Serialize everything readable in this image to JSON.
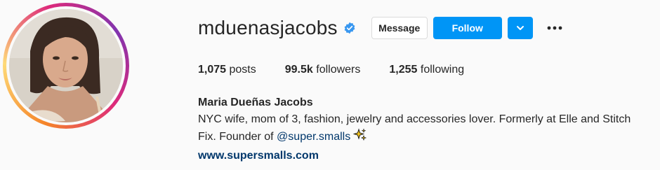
{
  "profile": {
    "username": "mduenasjacobs",
    "verified_icon": "verified-badge-icon",
    "avatar_icon": "profile-photo",
    "buttons": {
      "message": "Message",
      "follow": "Follow",
      "dropdown_icon": "chevron-down-icon",
      "more_icon": "more-options-icon"
    },
    "stats": {
      "posts_count": "1,075",
      "posts_label": "posts",
      "followers_count": "99.5k",
      "followers_label": "followers",
      "following_count": "1,255",
      "following_label": "following"
    },
    "bio": {
      "full_name": "Maria Dueñas Jacobs",
      "text_before": "NYC wife, mom of 3, fashion, jewelry and accessories lover. Formerly at Elle and Stitch Fix. Founder of ",
      "mention": "@super.smalls",
      "emoji_icon": "sparkles-icon",
      "website": "www.supersmalls.com"
    },
    "colors": {
      "accent_blue": "#0095f6",
      "link_blue": "#00376b",
      "text": "#262626",
      "background": "#fafafa"
    }
  }
}
